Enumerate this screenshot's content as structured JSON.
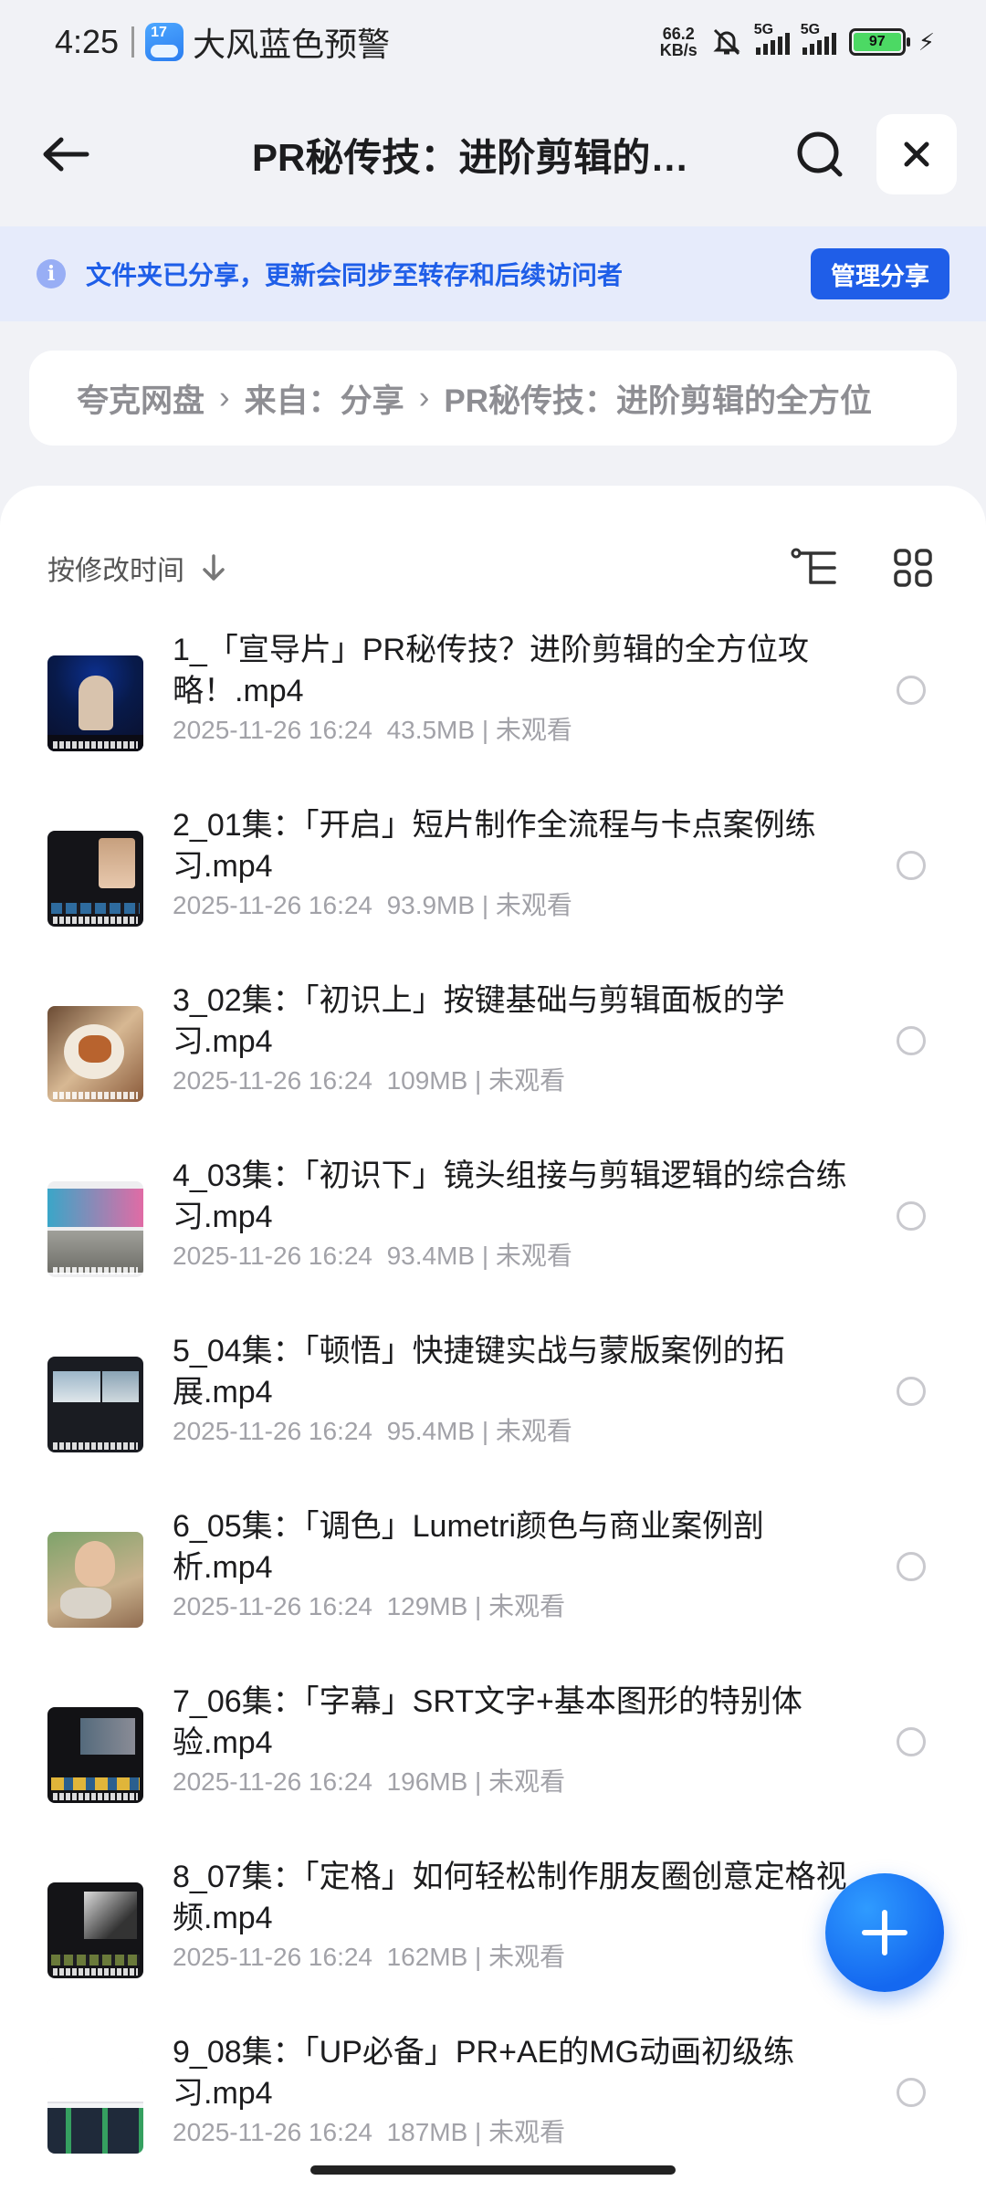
{
  "status_bar": {
    "time": "4:25",
    "weather_badge": "17",
    "alert": "大风蓝色预警",
    "net_speed_value": "66.2",
    "net_speed_unit": "KB/s",
    "signal1_tag": "5G",
    "signal2_tag": "5G",
    "battery": "97"
  },
  "header": {
    "title": "PR秘传技：进阶剪辑的全方位攻略"
  },
  "notice": {
    "text": "文件夹已分享，更新会同步至转存和后续访问者",
    "button": "管理分享"
  },
  "breadcrumb": {
    "items": [
      "夸克网盘",
      "来自：分享",
      "PR秘传技：进阶剪辑的全方位"
    ],
    "separator": "›"
  },
  "sort": {
    "label": "按修改时间"
  },
  "files": [
    {
      "name": "1_「宣导片」PR秘传技？进阶剪辑的全方位攻略！.mp4",
      "date": "2025-11-26 16:24",
      "size": "43.5MB",
      "status": "未观看"
    },
    {
      "name": "2_01集：「开启」短片制作全流程与卡点案例练习.mp4",
      "date": "2025-11-26 16:24",
      "size": "93.9MB",
      "status": "未观看"
    },
    {
      "name": "3_02集：「初识上」按键基础与剪辑面板的学习.mp4",
      "date": "2025-11-26 16:24",
      "size": "109MB",
      "status": "未观看"
    },
    {
      "name": "4_03集：「初识下」镜头组接与剪辑逻辑的综合练习.mp4",
      "date": "2025-11-26 16:24",
      "size": "93.4MB",
      "status": "未观看"
    },
    {
      "name": "5_04集：「顿悟」快捷键实战与蒙版案例的拓展.mp4",
      "date": "2025-11-26 16:24",
      "size": "95.4MB",
      "status": "未观看"
    },
    {
      "name": "6_05集：「调色」Lumetri颜色与商业案例剖析.mp4",
      "date": "2025-11-26 16:24",
      "size": "129MB",
      "status": "未观看"
    },
    {
      "name": "7_06集：「字幕」SRT文字+基本图形的特别体验.mp4",
      "date": "2025-11-26 16:24",
      "size": "196MB",
      "status": "未观看"
    },
    {
      "name": "8_07集：「定格」如何轻松制作朋友圈创意定格视频.mp4",
      "date": "2025-11-26 16:24",
      "size": "162MB",
      "status": "未观看"
    },
    {
      "name": "9_08集：「UP必备」PR+AE的MG动画初级练习.mp4",
      "date": "2025-11-26 16:24",
      "size": "187MB",
      "status": "未观看"
    }
  ],
  "colors": {
    "accent": "#1f5ee8",
    "banner_bg": "#e6ebfb",
    "page_bg": "#f1f2f6",
    "meta_text": "#a2a2a8"
  },
  "icons": {
    "back": "arrow-left-icon",
    "search": "search-icon",
    "close": "close-icon",
    "info": "info-icon",
    "sort": "arrow-down-icon",
    "tree": "tree-view-icon",
    "grid": "grid-view-icon",
    "add": "plus-icon"
  }
}
